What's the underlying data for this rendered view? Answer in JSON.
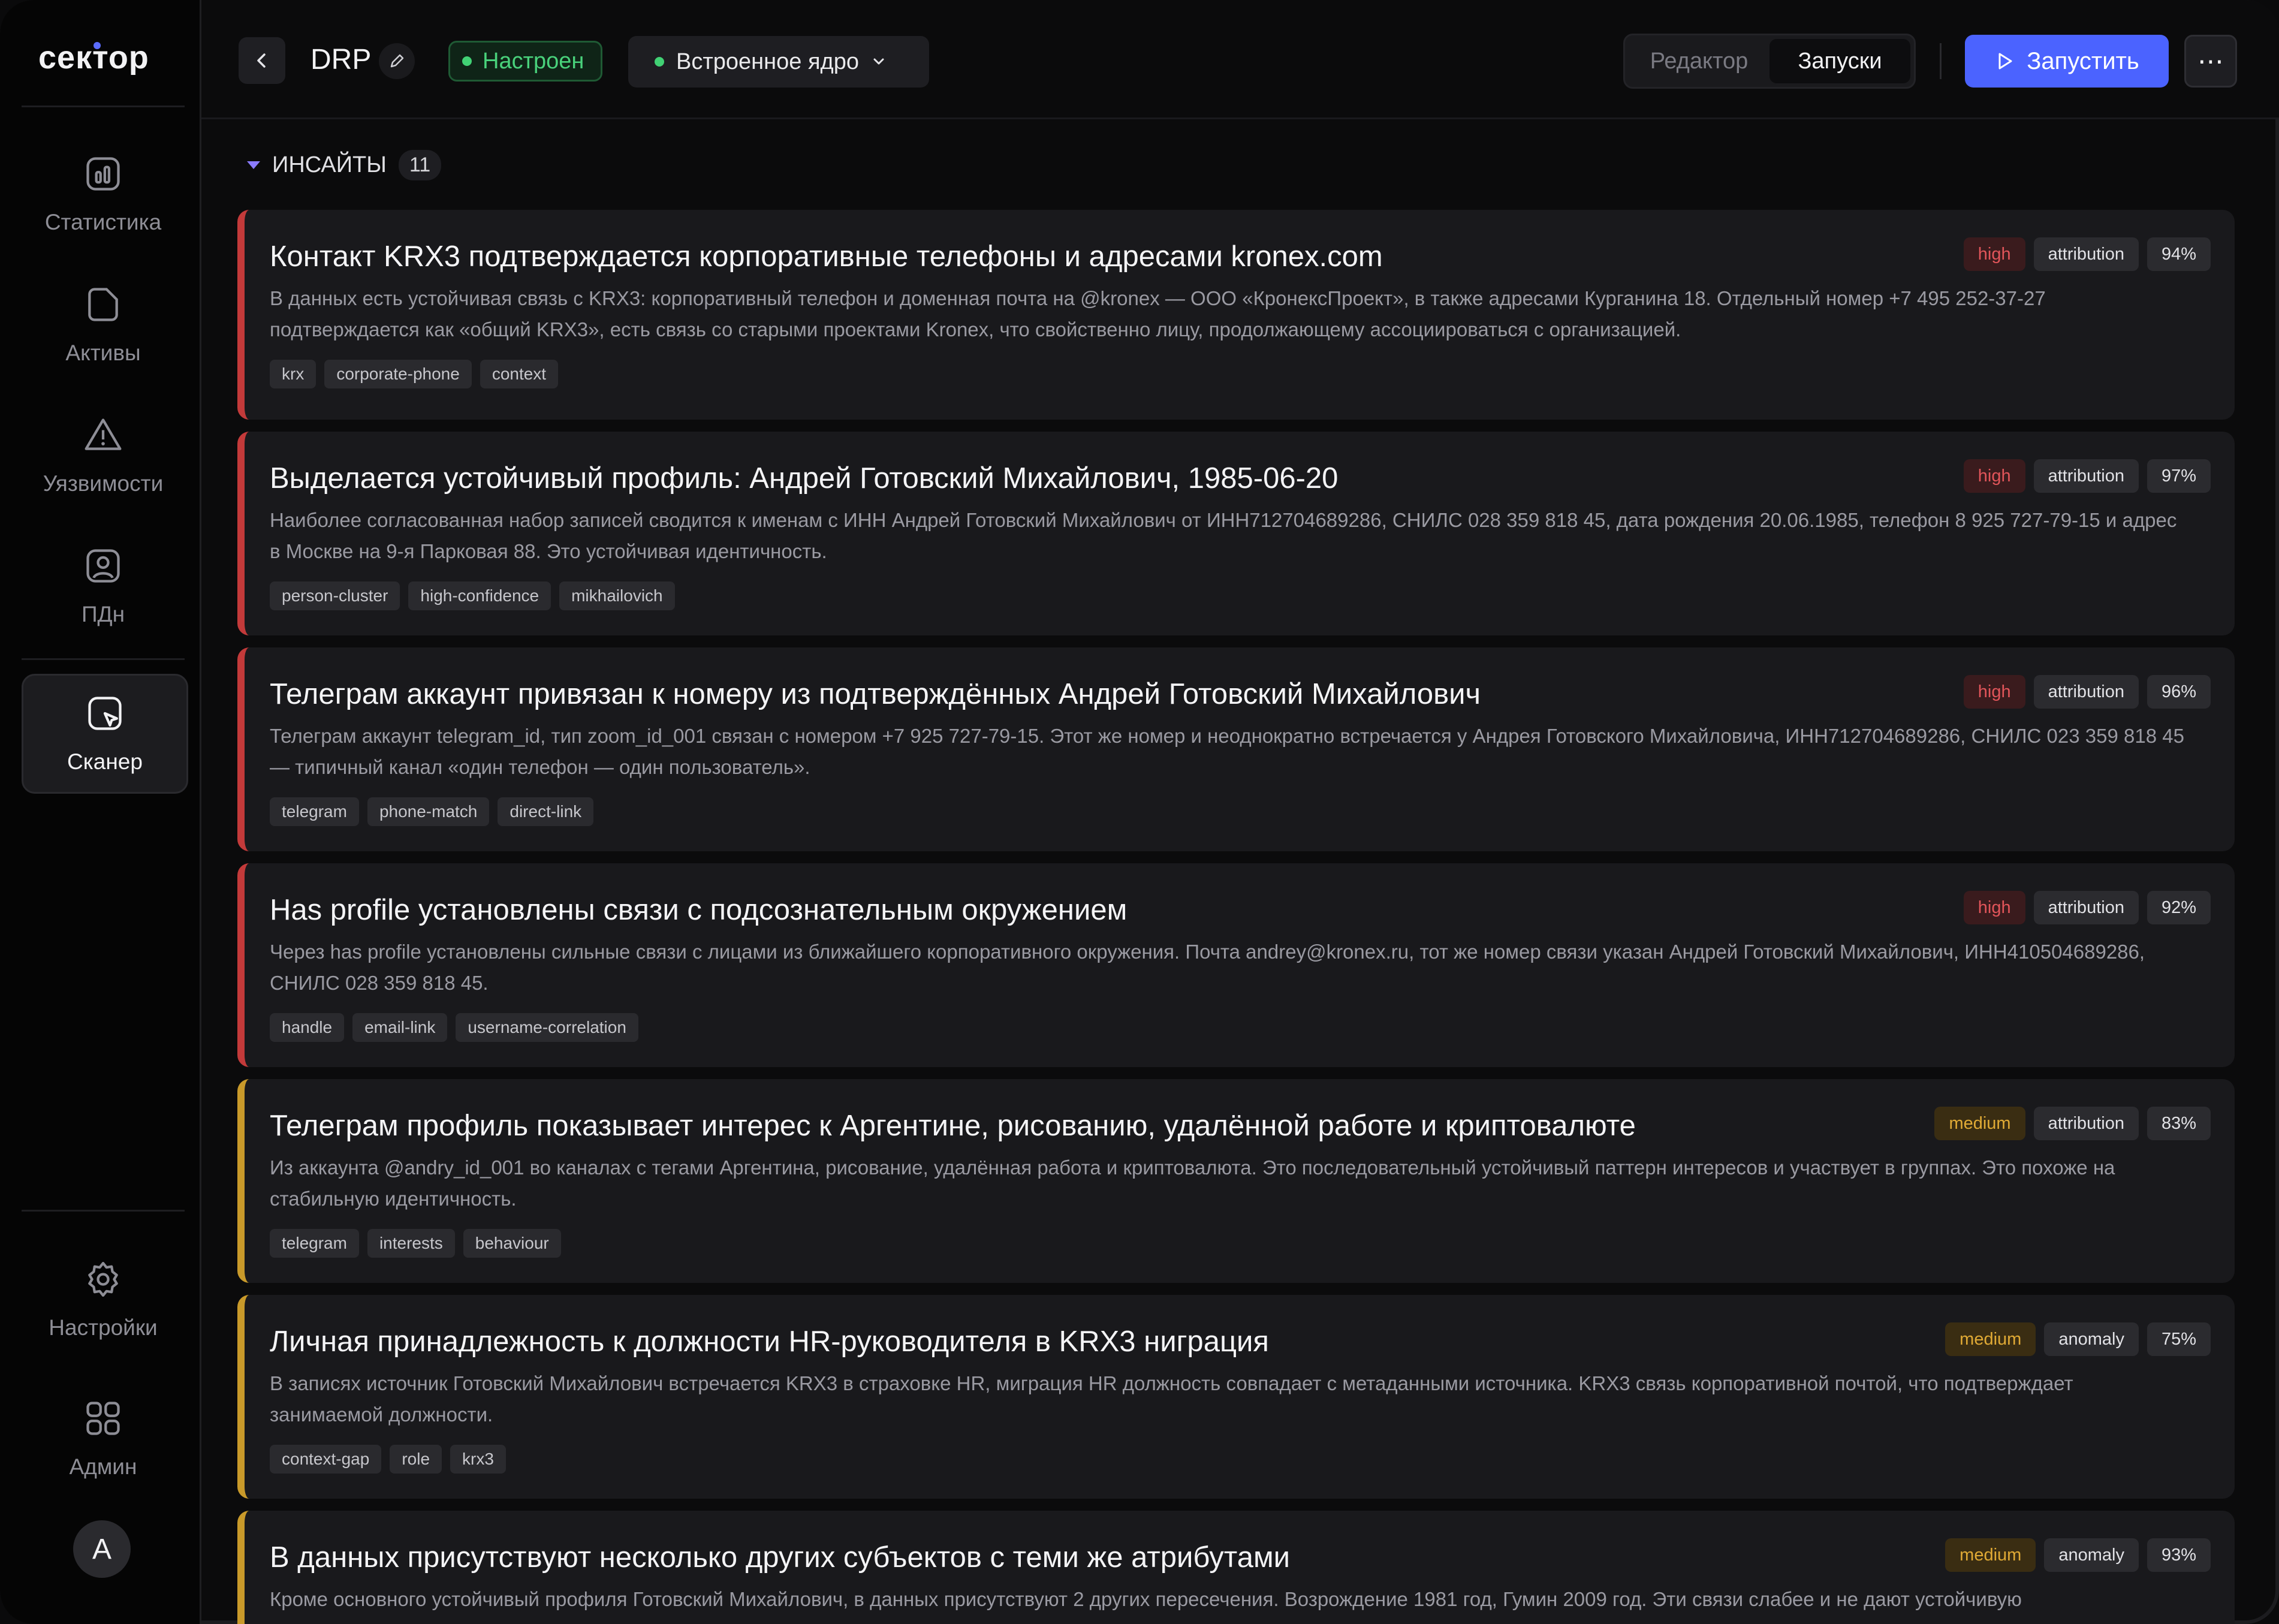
{
  "brand": {
    "logo": "сектор"
  },
  "sidebar": {
    "items": [
      {
        "label": "Статистика",
        "icon": "stats-icon"
      },
      {
        "label": "Активы",
        "icon": "folder-icon"
      },
      {
        "label": "Уязвимости",
        "icon": "warning-icon"
      },
      {
        "label": "ПДн",
        "icon": "user-id-icon"
      },
      {
        "label": "Сканер",
        "icon": "scanner-icon",
        "active": true
      }
    ],
    "bottom": [
      {
        "label": "Настройки",
        "icon": "gear-icon"
      },
      {
        "label": "Админ",
        "icon": "grid-icon"
      }
    ],
    "avatar": "A"
  },
  "header": {
    "title": "DRP",
    "status": "Настроен",
    "core": "Встроенное ядро",
    "tabs": [
      "Редактор",
      "Запуски"
    ],
    "active_tab": "Запуски",
    "run_label": "Запустить",
    "more": "⋯"
  },
  "section": {
    "title": "ИНСАЙТЫ",
    "count": "11"
  },
  "insights": [
    {
      "title": "Контакт KRX3 подтверждается корпоративные телефоны и адресами kronex.com",
      "desc": "В данных есть устойчивая связь с KRX3: корпоративный телефон и доменная почта на @kronex — ООО «КронексПроект», в также адресами Курганина 18. Отдельный номер +7 495 252-37-27 подтверждается как «общий KRX3», есть связь со старыми проектами Kronex, что свойственно лицу, продолжающему ассоциироваться с организацией.",
      "tags": [
        "krx",
        "corporate-phone",
        "context"
      ],
      "severity": "high",
      "type": "attribution",
      "confidence": "94%"
    },
    {
      "title": "Выделается устойчивый профиль: Андрей Готовский Михайлович, 1985-06-20",
      "desc": "Наиболее согласованная набор записей сводится к именам с ИНН Андрей Готовский Михайлович от ИНН712704689286, СНИЛС 028 359 818 45, дата рождения 20.06.1985, телефон 8 925 727-79-15 и адрес в Москве на 9-я Парковая 88. Это устойчивая идентичность.",
      "tags": [
        "person-cluster",
        "high-confidence",
        "mikhailovich"
      ],
      "severity": "high",
      "type": "attribution",
      "confidence": "97%"
    },
    {
      "title": "Телеграм аккаунт привязан к номеру из подтверждённых Андрей Готовский Михайлович",
      "desc": "Телеграм аккаунт telegram_id, тип zoom_id_001 связан с номером +7 925 727-79-15. Этот же номер и неоднократно встречается у Андрея Готовского Михайловича, ИНН712704689286, СНИЛС 023 359 818 45 — типичный канал «один телефон — один пользователь».",
      "tags": [
        "telegram",
        "phone-match",
        "direct-link"
      ],
      "severity": "high",
      "type": "attribution",
      "confidence": "96%"
    },
    {
      "title": "Has profile установлены связи с подсознательным окружением",
      "desc": "Через has profile установлены сильные связи с лицами из ближайшего корпоративного окружения. Почта andrey@kronex.ru, тот же номер связи указан Андрей Готовский Михайлович, ИНН410504689286, СНИЛС 028 359 818 45.",
      "tags": [
        "handle",
        "email-link",
        "username-correlation"
      ],
      "severity": "high",
      "type": "attribution",
      "confidence": "92%"
    },
    {
      "title": "Телеграм профиль показывает интерес к Аргентине, рисованию, удалённой работе и криптовалюте",
      "desc": "Из аккаунта @andry_id_001 во каналах с тегами Аргентина, рисование, удалённая работа и криптовалюта. Это последовательный устойчивый паттерн интересов и участвует в группах. Это похоже на стабильную идентичность.",
      "tags": [
        "telegram",
        "interests",
        "behaviour"
      ],
      "severity": "medium",
      "type": "attribution",
      "confidence": "83%"
    },
    {
      "title": "Личная принадлежность к должности HR-руководителя в KRX3 ниграция",
      "desc": "В записях источник Готовский Михайлович встречается KRX3 в страховке HR, миграция HR должность совпадает с метаданными источника. KRX3 связь корпоративной почтой, что подтверждает занимаемой должности.",
      "tags": [
        "context-gap",
        "role",
        "krx3"
      ],
      "severity": "medium",
      "type": "anomaly",
      "confidence": "75%"
    },
    {
      "title": "В данных присутствуют несколько других субъектов с теми же атрибутами",
      "desc": "Кроме основного устойчивый профиля Готовский Михайлович, в данных присутствуют 2 других пересечения. Возрождение 1981 год, Гумин 2009 год.  Эти связи слабее и не дают устойчивую",
      "tags": [],
      "severity": "medium",
      "type": "anomaly",
      "confidence": "93%"
    }
  ]
}
